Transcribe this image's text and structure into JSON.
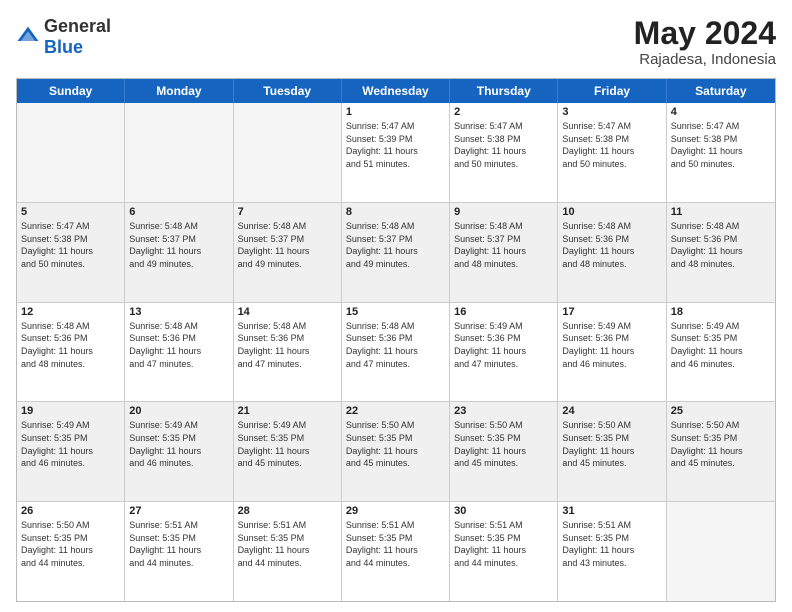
{
  "logo": {
    "general": "General",
    "blue": "Blue"
  },
  "title": {
    "month": "May 2024",
    "location": "Rajadesa, Indonesia"
  },
  "days_header": [
    "Sunday",
    "Monday",
    "Tuesday",
    "Wednesday",
    "Thursday",
    "Friday",
    "Saturday"
  ],
  "weeks": [
    [
      {
        "day": "",
        "text": "",
        "empty": true
      },
      {
        "day": "",
        "text": "",
        "empty": true
      },
      {
        "day": "",
        "text": "",
        "empty": true
      },
      {
        "day": "1",
        "text": "Sunrise: 5:47 AM\nSunset: 5:39 PM\nDaylight: 11 hours\nand 51 minutes.",
        "empty": false
      },
      {
        "day": "2",
        "text": "Sunrise: 5:47 AM\nSunset: 5:38 PM\nDaylight: 11 hours\nand 50 minutes.",
        "empty": false
      },
      {
        "day": "3",
        "text": "Sunrise: 5:47 AM\nSunset: 5:38 PM\nDaylight: 11 hours\nand 50 minutes.",
        "empty": false
      },
      {
        "day": "4",
        "text": "Sunrise: 5:47 AM\nSunset: 5:38 PM\nDaylight: 11 hours\nand 50 minutes.",
        "empty": false
      }
    ],
    [
      {
        "day": "5",
        "text": "Sunrise: 5:47 AM\nSunset: 5:38 PM\nDaylight: 11 hours\nand 50 minutes.",
        "empty": false
      },
      {
        "day": "6",
        "text": "Sunrise: 5:48 AM\nSunset: 5:37 PM\nDaylight: 11 hours\nand 49 minutes.",
        "empty": false
      },
      {
        "day": "7",
        "text": "Sunrise: 5:48 AM\nSunset: 5:37 PM\nDaylight: 11 hours\nand 49 minutes.",
        "empty": false
      },
      {
        "day": "8",
        "text": "Sunrise: 5:48 AM\nSunset: 5:37 PM\nDaylight: 11 hours\nand 49 minutes.",
        "empty": false
      },
      {
        "day": "9",
        "text": "Sunrise: 5:48 AM\nSunset: 5:37 PM\nDaylight: 11 hours\nand 48 minutes.",
        "empty": false
      },
      {
        "day": "10",
        "text": "Sunrise: 5:48 AM\nSunset: 5:36 PM\nDaylight: 11 hours\nand 48 minutes.",
        "empty": false
      },
      {
        "day": "11",
        "text": "Sunrise: 5:48 AM\nSunset: 5:36 PM\nDaylight: 11 hours\nand 48 minutes.",
        "empty": false
      }
    ],
    [
      {
        "day": "12",
        "text": "Sunrise: 5:48 AM\nSunset: 5:36 PM\nDaylight: 11 hours\nand 48 minutes.",
        "empty": false
      },
      {
        "day": "13",
        "text": "Sunrise: 5:48 AM\nSunset: 5:36 PM\nDaylight: 11 hours\nand 47 minutes.",
        "empty": false
      },
      {
        "day": "14",
        "text": "Sunrise: 5:48 AM\nSunset: 5:36 PM\nDaylight: 11 hours\nand 47 minutes.",
        "empty": false
      },
      {
        "day": "15",
        "text": "Sunrise: 5:48 AM\nSunset: 5:36 PM\nDaylight: 11 hours\nand 47 minutes.",
        "empty": false
      },
      {
        "day": "16",
        "text": "Sunrise: 5:49 AM\nSunset: 5:36 PM\nDaylight: 11 hours\nand 47 minutes.",
        "empty": false
      },
      {
        "day": "17",
        "text": "Sunrise: 5:49 AM\nSunset: 5:36 PM\nDaylight: 11 hours\nand 46 minutes.",
        "empty": false
      },
      {
        "day": "18",
        "text": "Sunrise: 5:49 AM\nSunset: 5:35 PM\nDaylight: 11 hours\nand 46 minutes.",
        "empty": false
      }
    ],
    [
      {
        "day": "19",
        "text": "Sunrise: 5:49 AM\nSunset: 5:35 PM\nDaylight: 11 hours\nand 46 minutes.",
        "empty": false
      },
      {
        "day": "20",
        "text": "Sunrise: 5:49 AM\nSunset: 5:35 PM\nDaylight: 11 hours\nand 46 minutes.",
        "empty": false
      },
      {
        "day": "21",
        "text": "Sunrise: 5:49 AM\nSunset: 5:35 PM\nDaylight: 11 hours\nand 45 minutes.",
        "empty": false
      },
      {
        "day": "22",
        "text": "Sunrise: 5:50 AM\nSunset: 5:35 PM\nDaylight: 11 hours\nand 45 minutes.",
        "empty": false
      },
      {
        "day": "23",
        "text": "Sunrise: 5:50 AM\nSunset: 5:35 PM\nDaylight: 11 hours\nand 45 minutes.",
        "empty": false
      },
      {
        "day": "24",
        "text": "Sunrise: 5:50 AM\nSunset: 5:35 PM\nDaylight: 11 hours\nand 45 minutes.",
        "empty": false
      },
      {
        "day": "25",
        "text": "Sunrise: 5:50 AM\nSunset: 5:35 PM\nDaylight: 11 hours\nand 45 minutes.",
        "empty": false
      }
    ],
    [
      {
        "day": "26",
        "text": "Sunrise: 5:50 AM\nSunset: 5:35 PM\nDaylight: 11 hours\nand 44 minutes.",
        "empty": false
      },
      {
        "day": "27",
        "text": "Sunrise: 5:51 AM\nSunset: 5:35 PM\nDaylight: 11 hours\nand 44 minutes.",
        "empty": false
      },
      {
        "day": "28",
        "text": "Sunrise: 5:51 AM\nSunset: 5:35 PM\nDaylight: 11 hours\nand 44 minutes.",
        "empty": false
      },
      {
        "day": "29",
        "text": "Sunrise: 5:51 AM\nSunset: 5:35 PM\nDaylight: 11 hours\nand 44 minutes.",
        "empty": false
      },
      {
        "day": "30",
        "text": "Sunrise: 5:51 AM\nSunset: 5:35 PM\nDaylight: 11 hours\nand 44 minutes.",
        "empty": false
      },
      {
        "day": "31",
        "text": "Sunrise: 5:51 AM\nSunset: 5:35 PM\nDaylight: 11 hours\nand 43 minutes.",
        "empty": false
      },
      {
        "day": "",
        "text": "",
        "empty": true
      }
    ]
  ]
}
